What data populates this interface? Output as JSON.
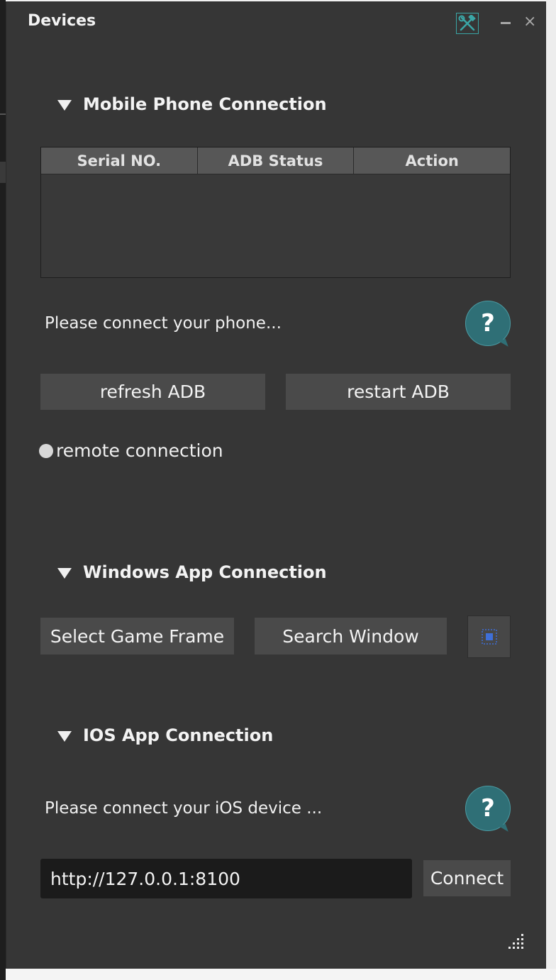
{
  "window": {
    "title": "Devices"
  },
  "mobile": {
    "section_title": "Mobile Phone Connection",
    "table": {
      "columns": [
        "Serial NO.",
        "ADB Status",
        "Action"
      ],
      "rows": []
    },
    "status_text": "Please connect your phone...",
    "refresh_label": "refresh ADB",
    "restart_label": "restart ADB",
    "remote_label": "remote connection"
  },
  "windows": {
    "section_title": "Windows App Connection",
    "select_frame_label": "Select Game Frame",
    "search_window_label": "Search Window"
  },
  "ios": {
    "section_title": "IOS App Connection",
    "status_text": "Please connect your iOS device ...",
    "url_value": "http://127.0.0.1:8100",
    "connect_label": "Connect"
  },
  "icons": {
    "tools": "tools-icon",
    "help": "help-bubble-icon",
    "target": "window-target-icon",
    "resize": "resize-grip-icon"
  },
  "colors": {
    "panel_bg": "#363636",
    "button_bg": "#4a4a4a",
    "accent": "#3aa6a6",
    "help_bg": "#2f6f76"
  }
}
